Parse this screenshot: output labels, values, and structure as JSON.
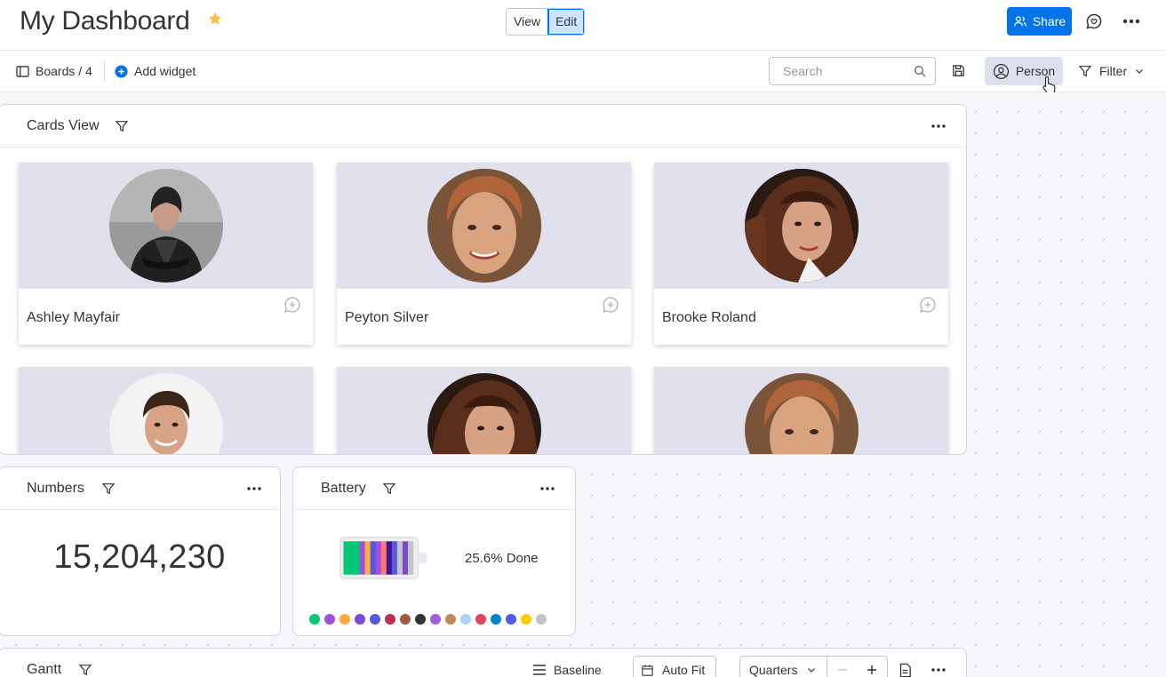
{
  "header": {
    "title": "My Dashboard",
    "view_label": "View",
    "edit_label": "Edit",
    "share_label": "Share"
  },
  "toolbar": {
    "boards_label": "Boards / 4",
    "add_widget_label": "Add widget",
    "search_placeholder": "Search",
    "person_label": "Person",
    "filter_label": "Filter"
  },
  "cards_view": {
    "title": "Cards View",
    "cards": [
      {
        "name": "Ashley Mayfair"
      },
      {
        "name": "Peyton Silver"
      },
      {
        "name": "Brooke Roland"
      },
      {
        "name": ""
      },
      {
        "name": ""
      },
      {
        "name": ""
      }
    ]
  },
  "numbers": {
    "title": "Numbers",
    "value": "15,204,230"
  },
  "battery": {
    "title": "Battery",
    "label": "25.6% Done",
    "progress_percent": 25.6,
    "stripe_colors": [
      "#00c875",
      "#00c875",
      "#00c875",
      "#9d50dd",
      "#fdab3d",
      "#5559df",
      "#9d50dd",
      "#ff7575",
      "#401694",
      "#5559df",
      "#c4c4c4",
      "#784bd1",
      "#c4c4c4"
    ],
    "status_colors": [
      "#00c875",
      "#9d50dd",
      "#fdab3d",
      "#784bd1",
      "#5559df",
      "#bb3354",
      "#a25b46",
      "#333333",
      "#a25ddc",
      "#c08a5b",
      "#a9d5f5",
      "#e2445c",
      "#0086c0",
      "#5559df",
      "#ffcb00",
      "#c4c4c4"
    ]
  },
  "gantt": {
    "title": "Gantt",
    "baseline_label": "Baseline",
    "autofit_label": "Auto Fit",
    "quarters_label": "Quarters"
  },
  "colors": {
    "primary": "#0073ea",
    "star": "#fdbc3f"
  }
}
